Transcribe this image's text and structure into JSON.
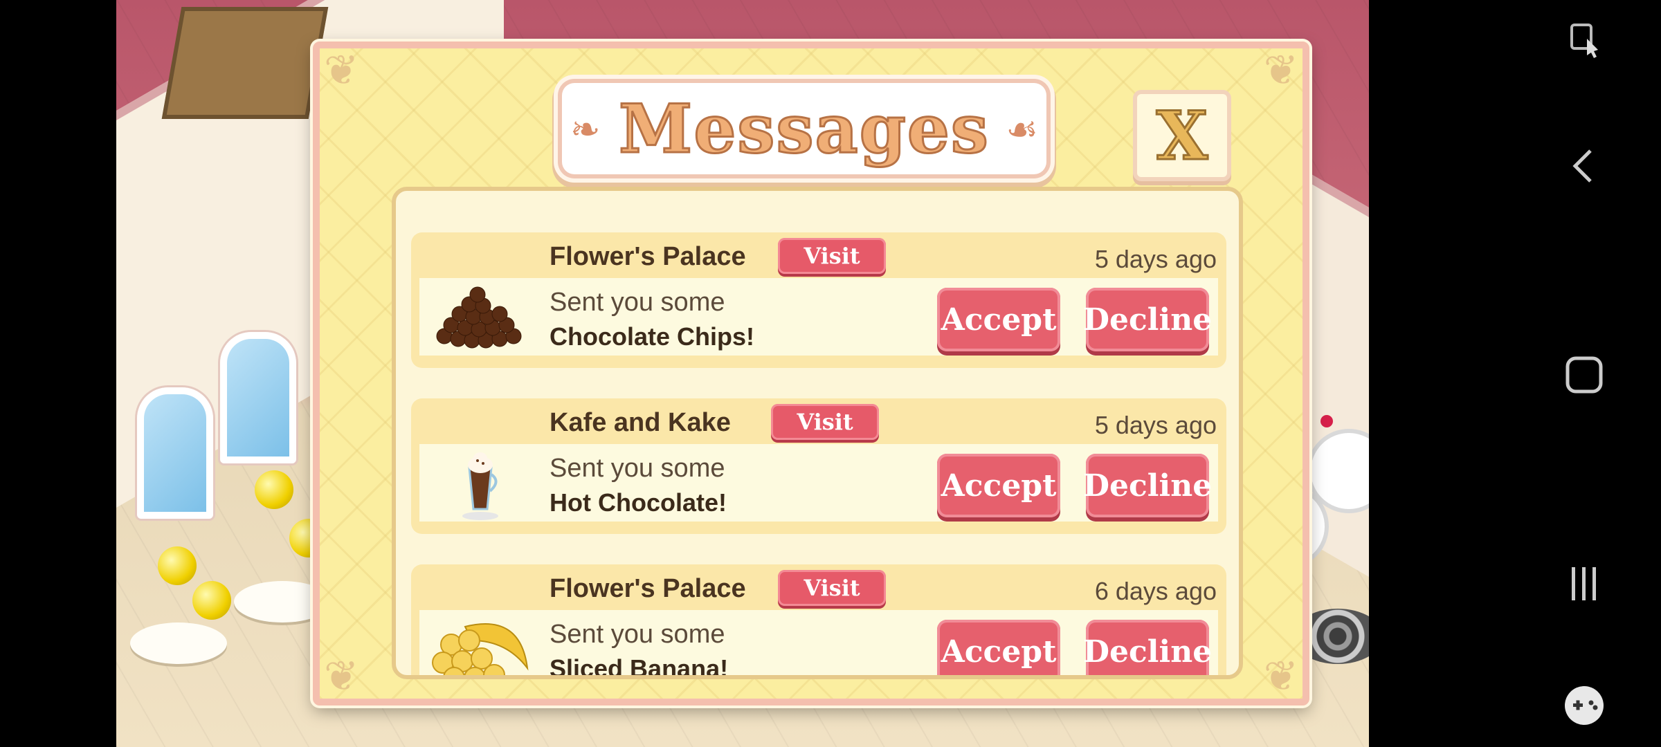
{
  "dialog": {
    "title": "Messages",
    "close_label": "X"
  },
  "messages": [
    {
      "sender": "Flower's Palace",
      "visit_label": "Visit",
      "time": "5 days ago",
      "sent_text": "Sent you some",
      "item": "Chocolate Chips!",
      "item_icon": "chocolate-chips-icon",
      "accept_label": "Accept",
      "decline_label": "Decline"
    },
    {
      "sender": "Kafe and Kake",
      "visit_label": "Visit",
      "time": "5 days ago",
      "sent_text": "Sent you some",
      "item": "Hot Chocolate!",
      "item_icon": "hot-chocolate-icon",
      "accept_label": "Accept",
      "decline_label": "Decline"
    },
    {
      "sender": "Flower's Palace",
      "visit_label": "Visit",
      "time": "6 days ago",
      "sent_text": "Sent you some",
      "item": "Sliced Banana!",
      "item_icon": "sliced-banana-icon",
      "accept_label": "Accept",
      "decline_label": "Decline"
    }
  ],
  "navbar": {
    "icons": [
      "screen-lock-icon",
      "back-icon",
      "home-icon",
      "recents-icon",
      "game-controller-icon"
    ]
  },
  "colors": {
    "button_red": "#e6606d",
    "dialog_yellow": "#fbeea0",
    "title_orange": "#f0ae76"
  }
}
